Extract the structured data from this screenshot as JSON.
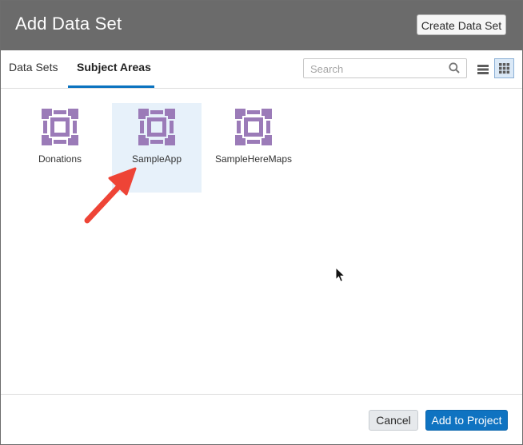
{
  "dialog": {
    "title": "Add Data Set",
    "create_button": "Create Data Set"
  },
  "tabs": [
    {
      "label": "Data Sets",
      "active": false
    },
    {
      "label": "Subject Areas",
      "active": true
    }
  ],
  "search": {
    "placeholder": "Search",
    "icon": "search-icon"
  },
  "view_toggle": {
    "list_icon": "list-view-icon",
    "grid_icon": "grid-view-icon",
    "selected": "grid"
  },
  "items": [
    {
      "label": "Donations",
      "icon": "subject-area-icon",
      "selected": false
    },
    {
      "label": "SampleApp",
      "icon": "subject-area-icon",
      "selected": true
    },
    {
      "label": "SampleHereMaps",
      "icon": "subject-area-icon",
      "selected": false
    }
  ],
  "footer": {
    "cancel_label": "Cancel",
    "add_label": "Add to Project"
  },
  "colors": {
    "titlebar": "#6b6b6b",
    "accent": "#0a73bf",
    "icon": "#9b7bb8",
    "selection": "#e7f1fa",
    "arrow": "#ee4436"
  }
}
